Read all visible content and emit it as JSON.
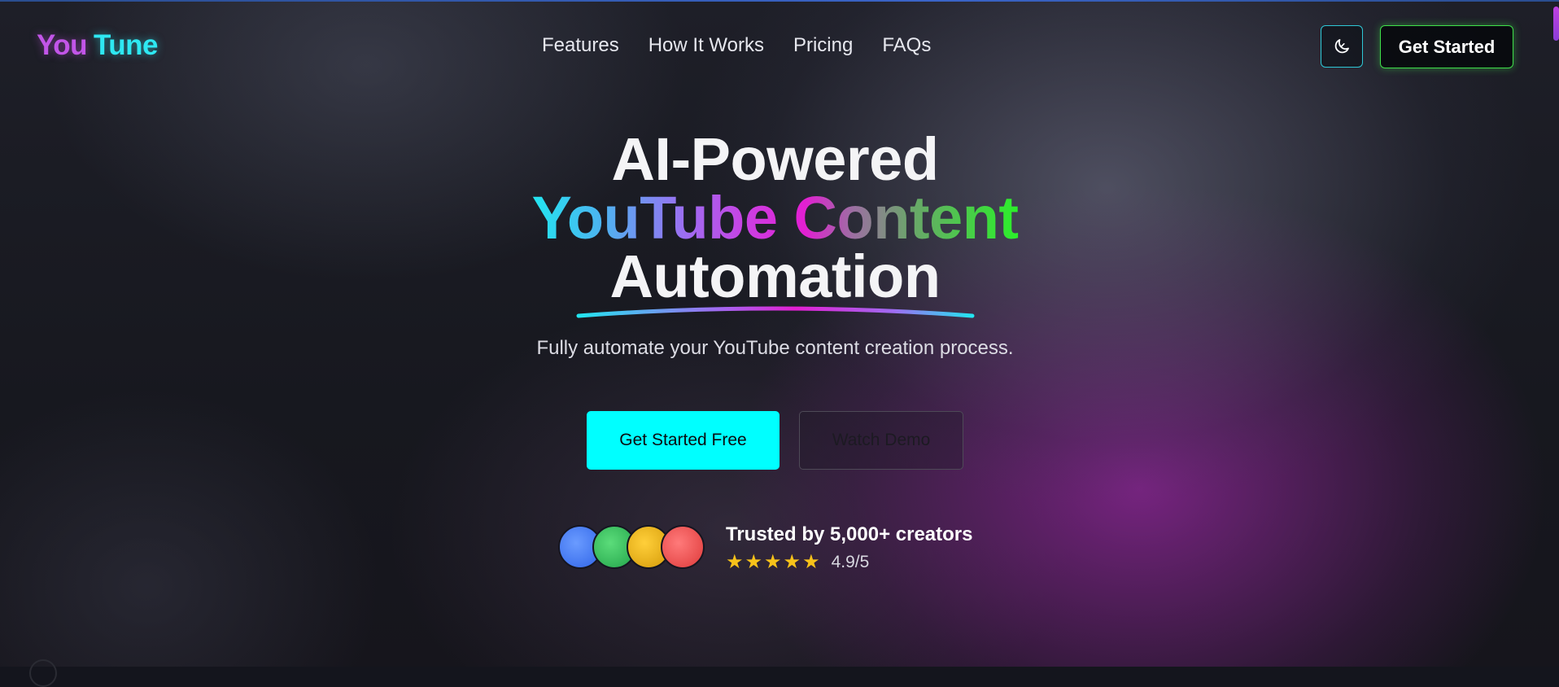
{
  "brand": {
    "name_part1": "You",
    "name_part2": "Tune"
  },
  "nav": {
    "items": [
      "Features",
      "How It Works",
      "Pricing",
      "FAQs"
    ]
  },
  "header": {
    "theme_toggle_icon": "moon-icon",
    "cta_label": "Get Started"
  },
  "hero": {
    "title_line1": "AI-Powered",
    "title_line2": "YouTube Content",
    "title_line3": "Automation",
    "subtitle": "Fully automate your YouTube content creation process.",
    "primary_cta": "Get Started Free",
    "secondary_cta": "Watch Demo"
  },
  "social_proof": {
    "trusted_text": "Trusted by 5,000+ creators",
    "stars": 5,
    "rating": "4.9/5",
    "avatar_colors": [
      "#3b82f6",
      "#22c55e",
      "#eab308",
      "#ef4444"
    ]
  },
  "colors": {
    "accent_cyan": "#00ffff",
    "accent_green": "#3fe04a",
    "accent_magenta": "#c255e8",
    "star": "#f7c21a"
  }
}
